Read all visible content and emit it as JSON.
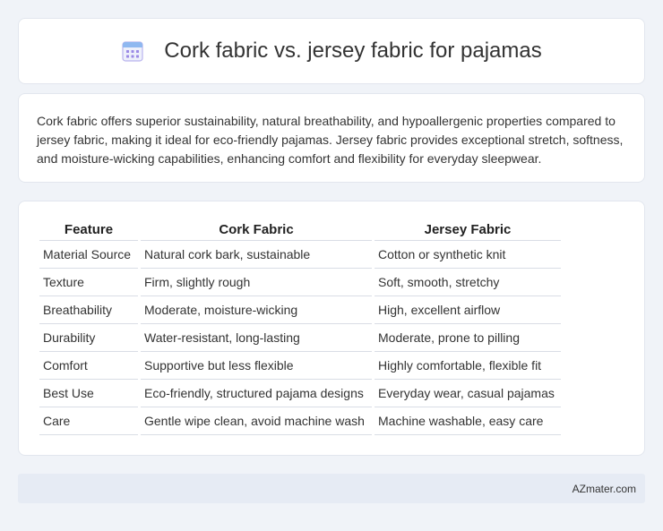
{
  "header": {
    "title": "Cork fabric vs. jersey fabric for pajamas",
    "icon": "calendar-icon"
  },
  "summary": {
    "text": "Cork fabric offers superior sustainability, natural breathability, and hypoallergenic properties compared to jersey fabric, making it ideal for eco-friendly pajamas. Jersey fabric provides exceptional stretch, softness, and moisture-wicking capabilities, enhancing comfort and flexibility for everyday sleepwear."
  },
  "table": {
    "headers": [
      "Feature",
      "Cork Fabric",
      "Jersey Fabric"
    ],
    "rows": [
      [
        "Material Source",
        "Natural cork bark, sustainable",
        "Cotton or synthetic knit"
      ],
      [
        "Texture",
        "Firm, slightly rough",
        "Soft, smooth, stretchy"
      ],
      [
        "Breathability",
        "Moderate, moisture-wicking",
        "High, excellent airflow"
      ],
      [
        "Durability",
        "Water-resistant, long-lasting",
        "Moderate, prone to pilling"
      ],
      [
        "Comfort",
        "Supportive but less flexible",
        "Highly comfortable, flexible fit"
      ],
      [
        "Best Use",
        "Eco-friendly, structured pajama designs",
        "Everyday wear, casual pajamas"
      ],
      [
        "Care",
        "Gentle wipe clean, avoid machine wash",
        "Machine washable, easy care"
      ]
    ]
  },
  "footer": {
    "text": "AZmater.com"
  },
  "colors": {
    "background": "#f0f3f8",
    "card": "#ffffff",
    "footer": "#e6ebf4",
    "icon_accent": "#8a7fe0"
  }
}
